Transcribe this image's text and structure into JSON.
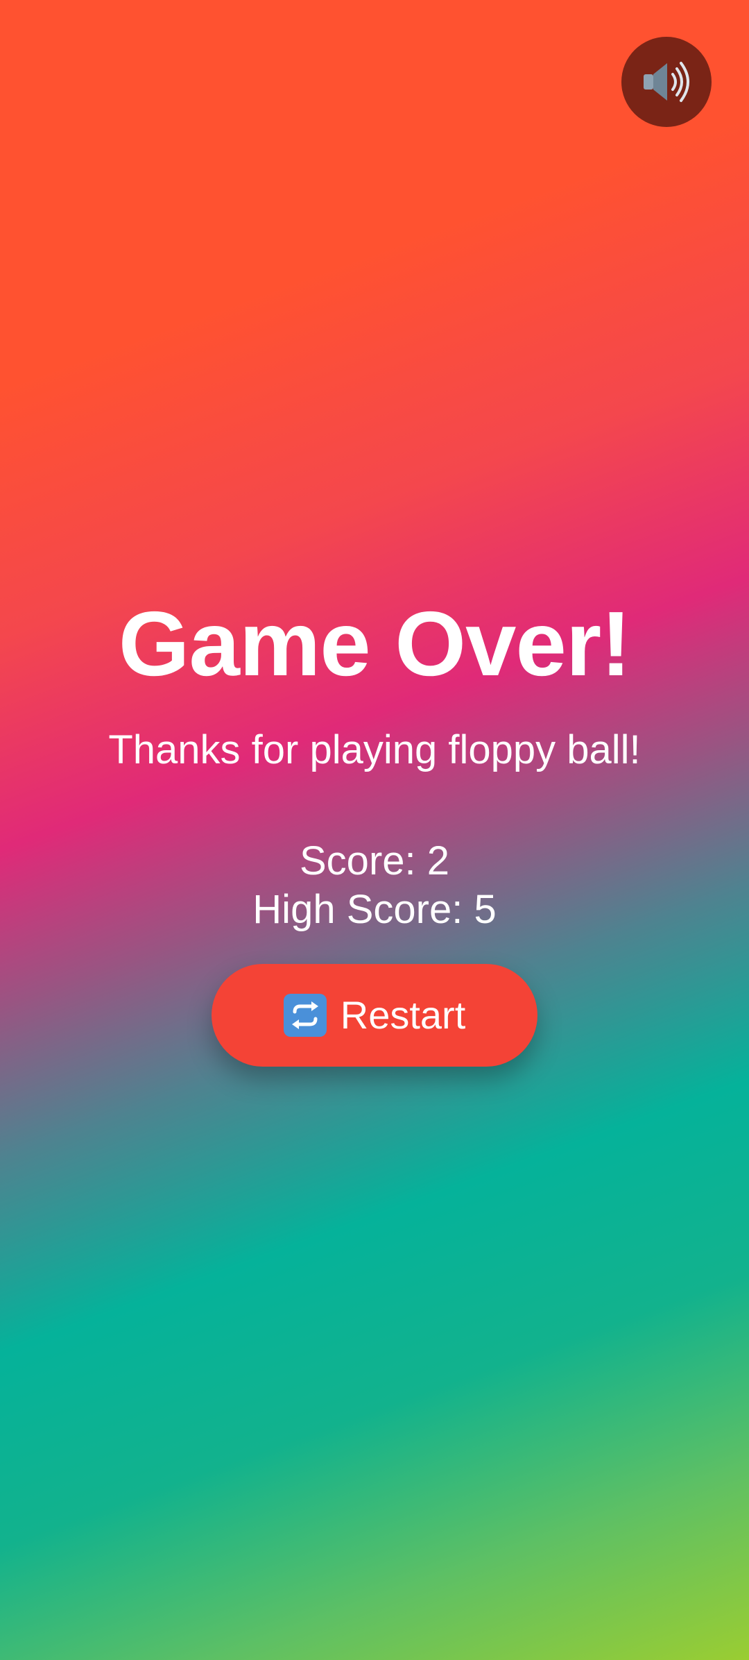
{
  "game": {
    "title": "Game Over!",
    "subtitle": "Thanks for playing floppy ball!",
    "score_text": "Score: 2",
    "high_score_text": "High Score: 5",
    "score": 2,
    "high_score": 5
  },
  "controls": {
    "restart_label": "Restart",
    "restart_icon": "repeat-arrows-icon",
    "sound_icon": "speaker-high-volume-icon"
  },
  "colors": {
    "restart_button": "#f44336",
    "sound_button": "#7a2416",
    "text": "#ffffff",
    "gradient_top": "#ff5230",
    "gradient_mid": "#e02a78",
    "gradient_teal": "#05b29a",
    "gradient_bottom": "#9acd32"
  }
}
